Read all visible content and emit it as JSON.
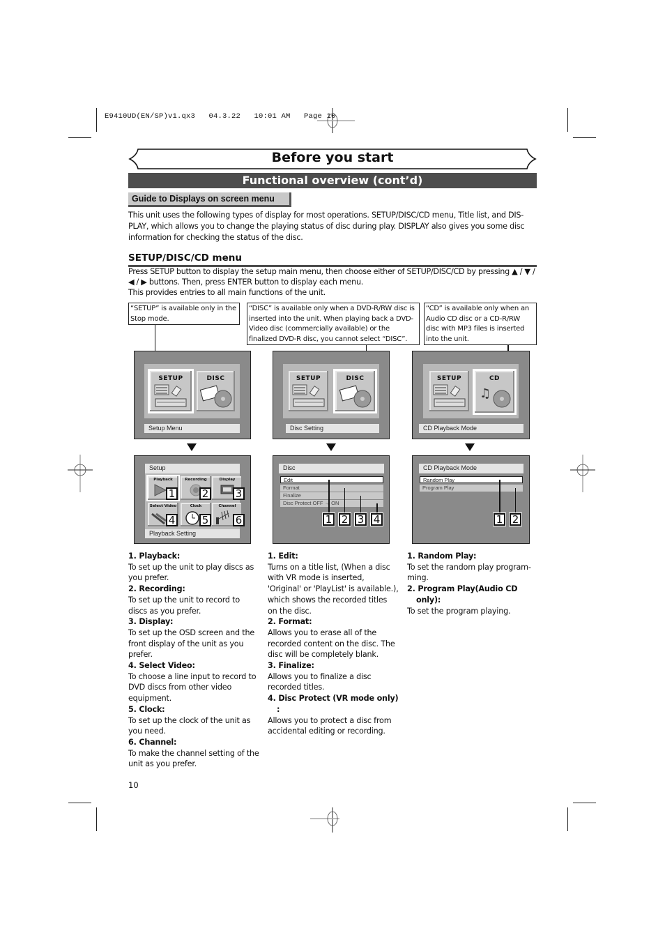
{
  "slug": "E9410UD(EN/SP)v1.qx3   04.3.22   10:01 AM   Page 10",
  "header": {
    "title": "Before you start",
    "subtitle": "Functional overview (cont’d)",
    "guide_tab": "Guide to Displays on screen menu"
  },
  "intro": "This unit uses the following types of display for most operations. SETUP/DISC/CD menu, Title list, and DIS-PLAY, which allows you to change the playing status of disc during play. DISPLAY also gives you some disc information for checking the status of the disc.",
  "section": {
    "heading": "SETUP/DISC/CD menu",
    "line1": "Press SETUP button to display the setup main menu, then choose either of SETUP/DISC/CD by pressing ▲ / ▼ /",
    "line2": "◀ / ▶ buttons. Then, press ENTER button to display each menu.",
    "line3": "This provides entries to all main functions of the unit."
  },
  "notes": {
    "setup": "“SETUP” is available only in the Stop mode.",
    "disc": "“DISC” is available only when a DVD-R/RW disc is inserted into the unit.  When playing back a DVD-Video disc (commercially available) or the finalized DVD-R disc, you cannot select “DISC”.",
    "cd": "“CD” is available only when an Audio CD disc or a CD-R/RW disc with MP3 files is inserted into the unit."
  },
  "top_screens": [
    {
      "tiles": [
        "SETUP",
        "DISC"
      ],
      "selected": 0,
      "caption": "Setup Menu"
    },
    {
      "tiles": [
        "SETUP",
        "DISC"
      ],
      "selected": 1,
      "caption": "Disc Setting"
    },
    {
      "tiles": [
        "SETUP",
        "CD"
      ],
      "selected": 1,
      "caption": "CD Playback Mode"
    }
  ],
  "setup_screen": {
    "title": "Setup",
    "tiles": [
      "Playback",
      "Recording",
      "Display",
      "Select Video",
      "Clock",
      "Channel"
    ],
    "numbers": [
      "1",
      "2",
      "3",
      "4",
      "5",
      "6"
    ],
    "caption": "Playback Setting"
  },
  "disc_screen": {
    "title": "Disc",
    "items": [
      "Edit",
      "Format",
      "Finalize",
      "Disc Protect OFF → ON"
    ],
    "numbers": [
      "1",
      "2",
      "3",
      "4"
    ]
  },
  "cd_screen": {
    "title": "CD Playback Mode",
    "items": [
      "Random Play",
      "Program Play"
    ],
    "numbers": [
      "1",
      "2"
    ]
  },
  "columns": {
    "setup": [
      {
        "head": "1. Playback:",
        "body": "To set up the unit to play discs as you prefer."
      },
      {
        "head": "2. Recording:",
        "body": "To set up the unit to record to discs as you prefer."
      },
      {
        "head": "3. Display:",
        "body": "To set up the OSD screen and the front display of the unit as you prefer."
      },
      {
        "head": "4. Select Video:",
        "body": "To choose a line input to record to DVD discs from other video equipment."
      },
      {
        "head": "5. Clock:",
        "body": "To set up the clock of the unit as you need."
      },
      {
        "head": "6. Channel:",
        "body": "To make the channel setting of the unit as you prefer."
      }
    ],
    "disc": [
      {
        "head": "1. Edit:",
        "body": "Turns on a title list, (When a disc with VR mode is inserted, 'Original' or 'PlayList' is available.), which shows the recorded titles on the disc."
      },
      {
        "head": "2. Format:",
        "body": "Allows you to erase all of the recorded content on the disc. The disc will be completely blank."
      },
      {
        "head": "3. Finalize:",
        "body": "Allows you to finalize a disc recorded titles."
      },
      {
        "head": "4. Disc Protect (VR mode only) :",
        "body": "Allows you to protect a disc from accidental editing or recording."
      }
    ],
    "cd": [
      {
        "head": "1. Random Play:",
        "body": "To set the random play program-ming."
      },
      {
        "head": "2. Program Play(Audio CD only):",
        "body": "To set the program playing."
      }
    ]
  },
  "page_number": "10"
}
